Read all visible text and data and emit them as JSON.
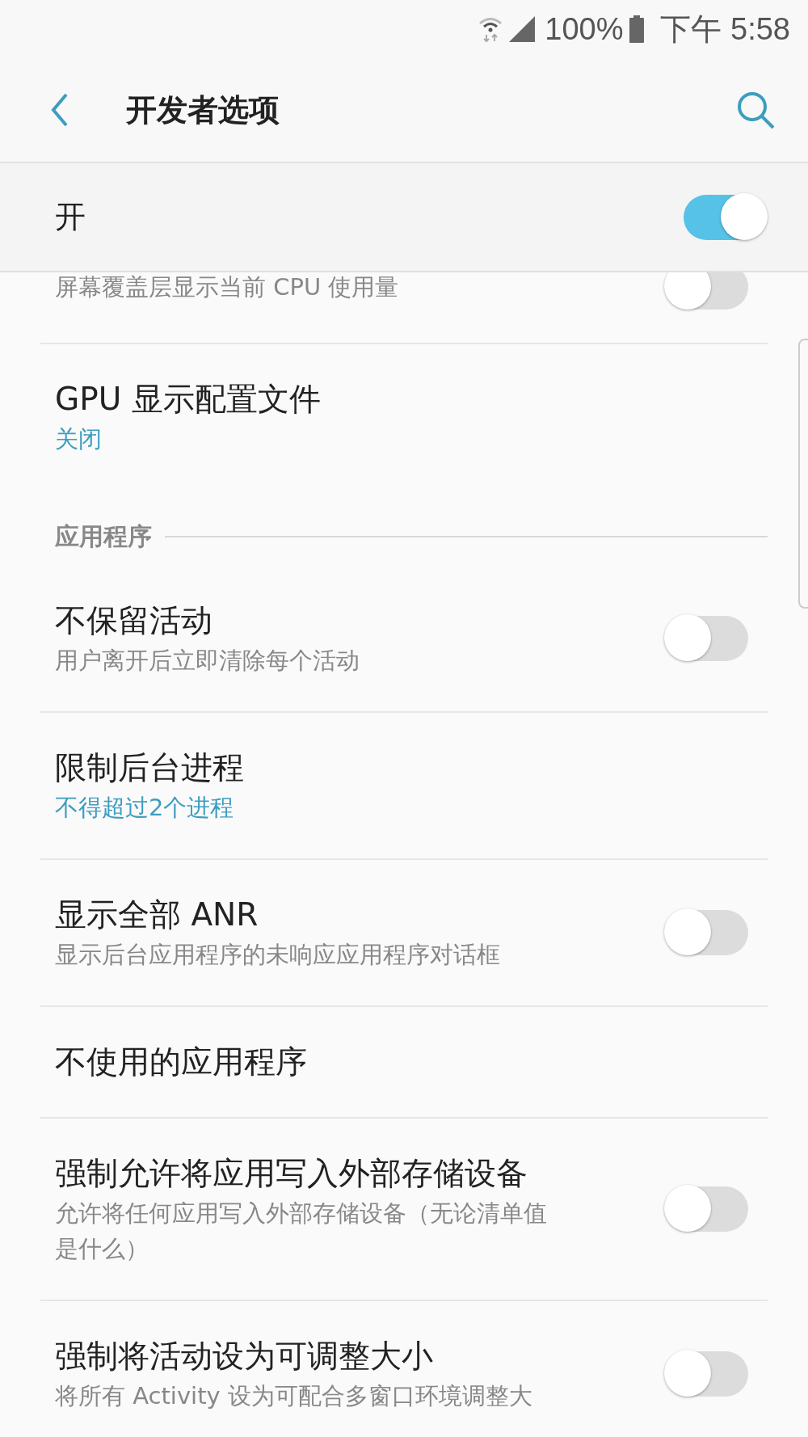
{
  "status_bar": {
    "battery": "100%",
    "time": "下午 5:58"
  },
  "header": {
    "title": "开发者选项"
  },
  "master_switch": {
    "label": "开",
    "on": true
  },
  "items": [
    {
      "kind": "switch",
      "subtitle": "屏幕覆盖层显示当前 CPU 使用量",
      "on": false
    },
    {
      "kind": "value",
      "title": "GPU 显示配置文件",
      "value": "关闭"
    },
    {
      "kind": "section",
      "title": "应用程序"
    },
    {
      "kind": "switch",
      "title": "不保留活动",
      "subtitle": "用户离开后立即清除每个活动",
      "on": false
    },
    {
      "kind": "value",
      "title": "限制后台进程",
      "value": "不得超过2个进程"
    },
    {
      "kind": "switch",
      "title": "显示全部 ANR",
      "subtitle": "显示后台应用程序的未响应应用程序对话框",
      "on": false
    },
    {
      "kind": "plain",
      "title": "不使用的应用程序"
    },
    {
      "kind": "switch",
      "title": "强制允许将应用写入外部存储设备",
      "subtitle": "允许将任何应用写入外部存储设备（无论清单值是什么）",
      "on": false
    },
    {
      "kind": "switch",
      "title": "强制将活动设为可调整大小",
      "subtitle": "将所有 Activity 设为可配合多窗口环境调整大",
      "on": false
    }
  ]
}
